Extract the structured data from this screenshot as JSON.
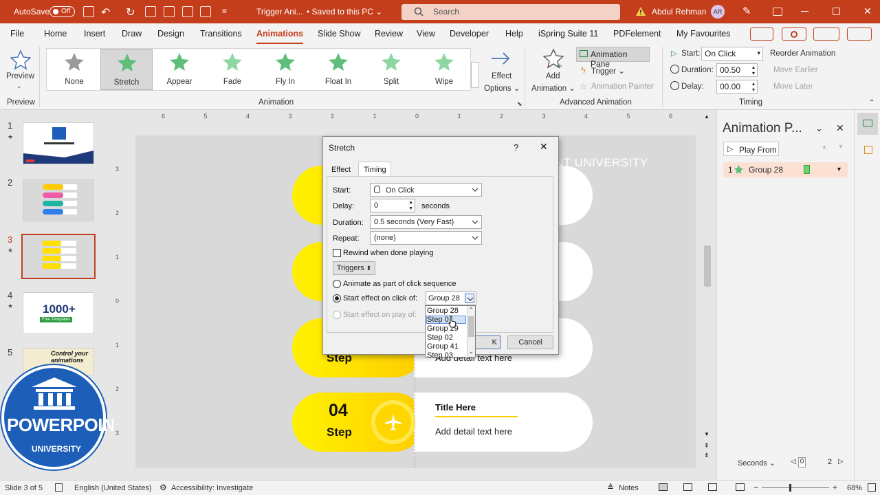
{
  "titlebar": {
    "autosave_label": "AutoSave",
    "autosave_state": "Off",
    "doc_title": "Trigger Ani...",
    "saved_status": "• Saved to this PC ⌄",
    "search_placeholder": "Search",
    "user_name": "Abdul Rehman",
    "user_initials": "AR",
    "accent_color": "#c43e1c"
  },
  "menu": {
    "tabs": [
      "File",
      "Home",
      "Insert",
      "Draw",
      "Design",
      "Transitions",
      "Animations",
      "Slide Show",
      "Review",
      "View",
      "Developer",
      "Help",
      "iSpring Suite 11",
      "PDFelement",
      "My Favourites"
    ],
    "active": "Animations"
  },
  "ribbon": {
    "preview_label": "Preview",
    "preview_group": "Preview",
    "animation_group": "Animation",
    "gallery": [
      "None",
      "Stretch",
      "Appear",
      "Fade",
      "Fly In",
      "Float In",
      "Split",
      "Wipe"
    ],
    "gallery_selected": "Stretch",
    "effect_options": [
      "Effect",
      "Options ⌄"
    ],
    "add_animation": [
      "Add",
      "Animation ⌄"
    ],
    "animation_pane": "Animation Pane",
    "trigger": "Trigger ⌄",
    "animation_painter": "Animation Painter",
    "advanced_group": "Advanced Animation",
    "start_label": "Start:",
    "start_value": "On Click",
    "duration_label": "Duration:",
    "duration_value": "00.50",
    "delay_label": "Delay:",
    "delay_value": "00.00",
    "reorder": "Reorder Animation",
    "move_earlier": "Move Earlier",
    "move_later": "Move Later",
    "timing_group": "Timing"
  },
  "thumbnails": [
    {
      "num": "1",
      "star": "★"
    },
    {
      "num": "2",
      "star": ""
    },
    {
      "num": "3",
      "star": "★"
    },
    {
      "num": "4",
      "star": "★"
    },
    {
      "num": "5",
      "star": ""
    }
  ],
  "thumb4_text": "1000+",
  "thumb4_sub": "Free Templates",
  "thumb5_text": "Control your animations",
  "ruler_h": [
    "6",
    "5",
    "4",
    "3",
    "2",
    "1",
    "0",
    "1",
    "2",
    "3",
    "4",
    "5",
    "6"
  ],
  "ruler_v": [
    "3",
    "2",
    "1",
    "0",
    "1",
    "2",
    "3"
  ],
  "slide": {
    "header_text": "NT UNIVERSITY",
    "step_num": "04",
    "step_label": "Step",
    "step3_label": "Step",
    "title4": "Title Here",
    "detail3": "Add detail text here",
    "detail4": "Add detail text here"
  },
  "dialog": {
    "title": "Stretch",
    "help": "?",
    "close": "✕",
    "tabs": [
      "Effect",
      "Timing"
    ],
    "active_tab": "Timing",
    "start_label": "Start:",
    "start_value": "On Click",
    "delay_label": "Delay:",
    "delay_value": "0",
    "delay_unit": "seconds",
    "duration_label": "Duration:",
    "duration_value": "0.5 seconds (Very Fast)",
    "repeat_label": "Repeat:",
    "repeat_value": "(none)",
    "rewind_label": "Rewind when done playing",
    "triggers_button": "Triggers",
    "opt_sequence": "Animate as part of click sequence",
    "opt_click": "Start effect on click of:",
    "opt_click_value": "Group 28",
    "opt_play": "Start effect on play of:",
    "ok": "OK",
    "ok_visible": "K",
    "cancel": "Cancel",
    "dropdown_items": [
      "Group 28",
      "Step 0",
      "Group 29",
      "Step 02",
      "Group 41",
      "Step 03"
    ],
    "dropdown_highlight": "Step 0"
  },
  "animpane": {
    "title": "Animation P...",
    "play_from": "Play From",
    "item_num": "1",
    "item_name": "Group 28",
    "seconds": "Seconds ⌄",
    "page_from": "0",
    "page_to": "2",
    "item_color": "#fbe0d3"
  },
  "status": {
    "slide": "Slide 3 of 5",
    "language": "English (United States)",
    "accessibility": "Accessibility: Investigate",
    "notes": "Notes",
    "zoom": "68%"
  },
  "logo": {
    "text": "POWERPOINT",
    "sub": "UNIVERSITY"
  }
}
